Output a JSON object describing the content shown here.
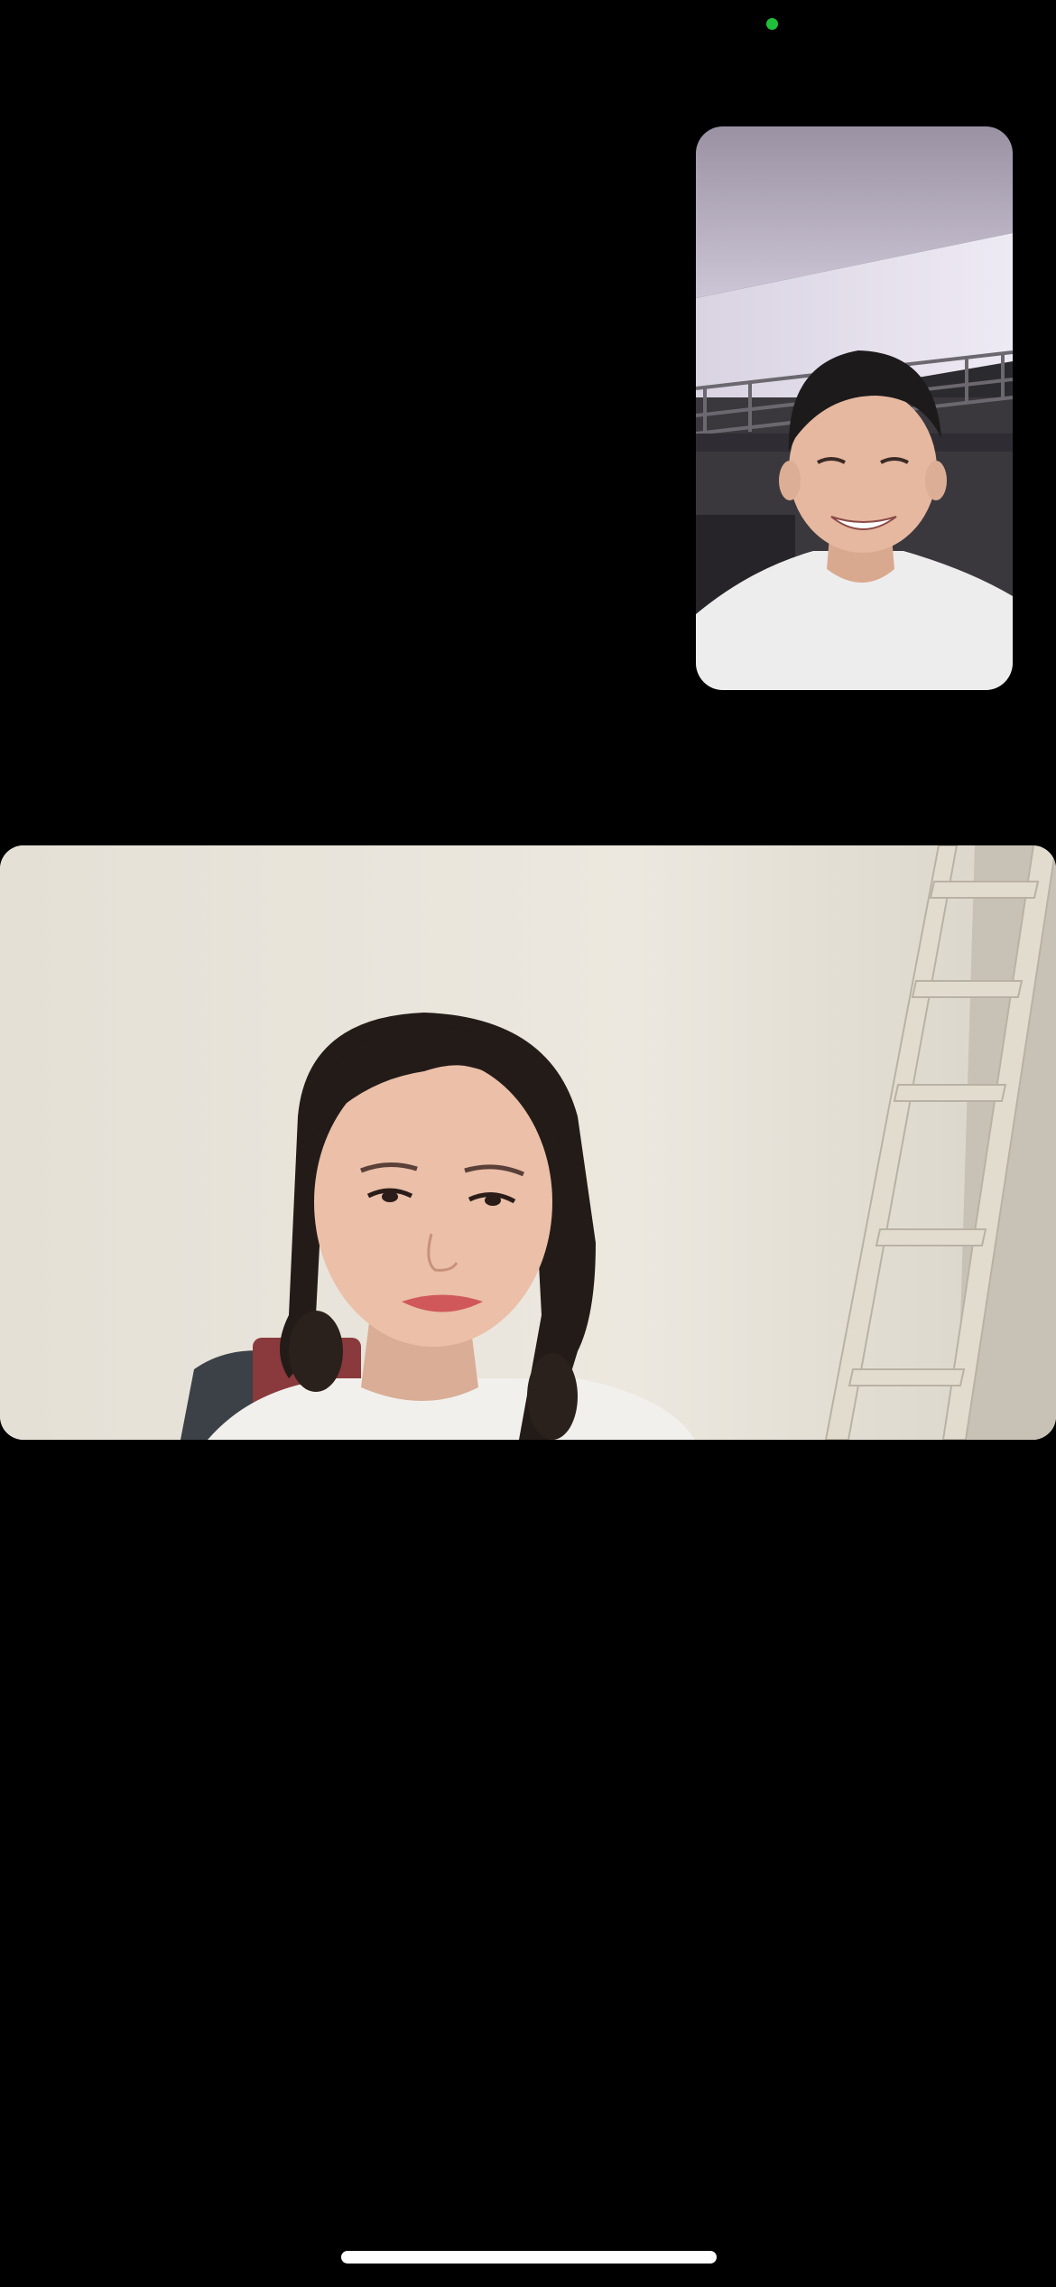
{
  "status_bar": {
    "camera_indicator": {
      "icon": "camera-in-use-dot-icon",
      "color": "#1fbf3a"
    }
  },
  "call": {
    "self_view": {
      "content": "self-camera-video",
      "mirrored": true
    },
    "remote_view": {
      "content": "remote-participant-video"
    }
  },
  "colors": {
    "background": "#000000",
    "home_indicator": "#ffffff"
  }
}
